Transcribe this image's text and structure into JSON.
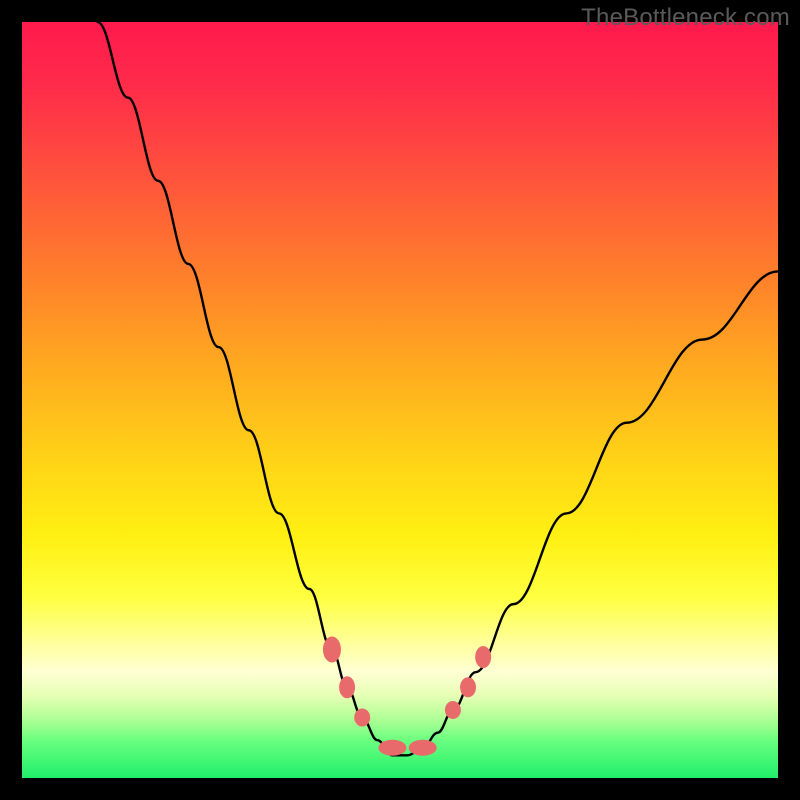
{
  "watermark": "TheBottleneck.com",
  "chart_data": {
    "type": "line",
    "title": "",
    "xlabel": "",
    "ylabel": "",
    "xlim": [
      0,
      100
    ],
    "ylim": [
      0,
      100
    ],
    "series": [
      {
        "name": "curve",
        "x": [
          10,
          14,
          18,
          22,
          26,
          30,
          34,
          38,
          41,
          43,
          45,
          47,
          49,
          51,
          53,
          55,
          57,
          60,
          65,
          72,
          80,
          90,
          100
        ],
        "y": [
          100,
          90,
          79,
          68,
          57,
          46,
          35,
          25,
          17,
          12,
          8,
          5,
          3,
          3,
          4,
          6,
          9,
          14,
          23,
          35,
          47,
          58,
          67
        ]
      }
    ],
    "markers": {
      "name": "highlight-points",
      "color": "#e96a6a",
      "points": [
        {
          "x": 41,
          "y": 17,
          "rx": 9,
          "ry": 13
        },
        {
          "x": 43,
          "y": 12,
          "rx": 8,
          "ry": 11
        },
        {
          "x": 45,
          "y": 8,
          "rx": 8,
          "ry": 9
        },
        {
          "x": 49,
          "y": 4,
          "rx": 14,
          "ry": 8
        },
        {
          "x": 53,
          "y": 4,
          "rx": 14,
          "ry": 8
        },
        {
          "x": 57,
          "y": 9,
          "rx": 8,
          "ry": 9
        },
        {
          "x": 59,
          "y": 12,
          "rx": 8,
          "ry": 10
        },
        {
          "x": 61,
          "y": 16,
          "rx": 8,
          "ry": 11
        }
      ]
    }
  }
}
